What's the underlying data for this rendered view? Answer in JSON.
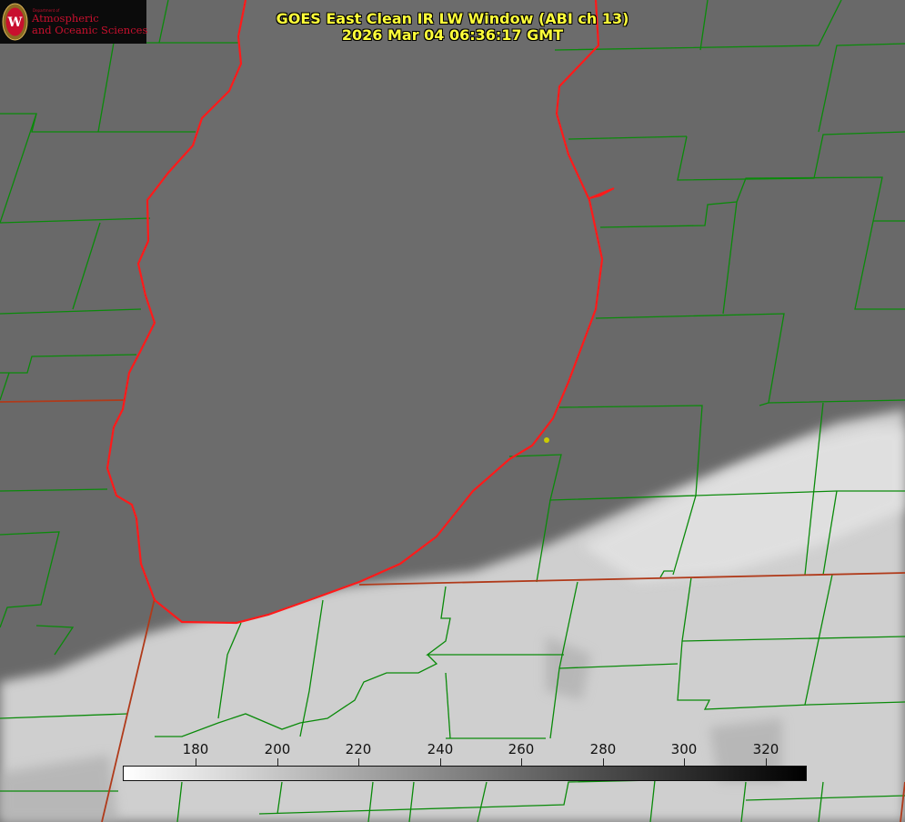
{
  "header": {
    "title_line1": "GOES East Clean IR LW Window (ABI ch 13)",
    "title_line2": "2026 Mar 04 06:36:17 GMT"
  },
  "logo": {
    "small_text": "Department of",
    "line1": "Atmospheric",
    "line2": "and Oceanic Sciences",
    "color": "#c8102e"
  },
  "colorbar": {
    "ticks": [
      "180",
      "200",
      "220",
      "240",
      "260",
      "280",
      "300",
      "320"
    ],
    "gradient_start": "#ffffff",
    "gradient_end": "#000000"
  },
  "map": {
    "land_color": "#696969",
    "cloud_color": "#d0d0d0",
    "county_line_color": "#0a8a0a",
    "state_line_color": "#b03a1a",
    "coastline_color": "#ff1a1a",
    "marker_color": "#cccc00"
  }
}
